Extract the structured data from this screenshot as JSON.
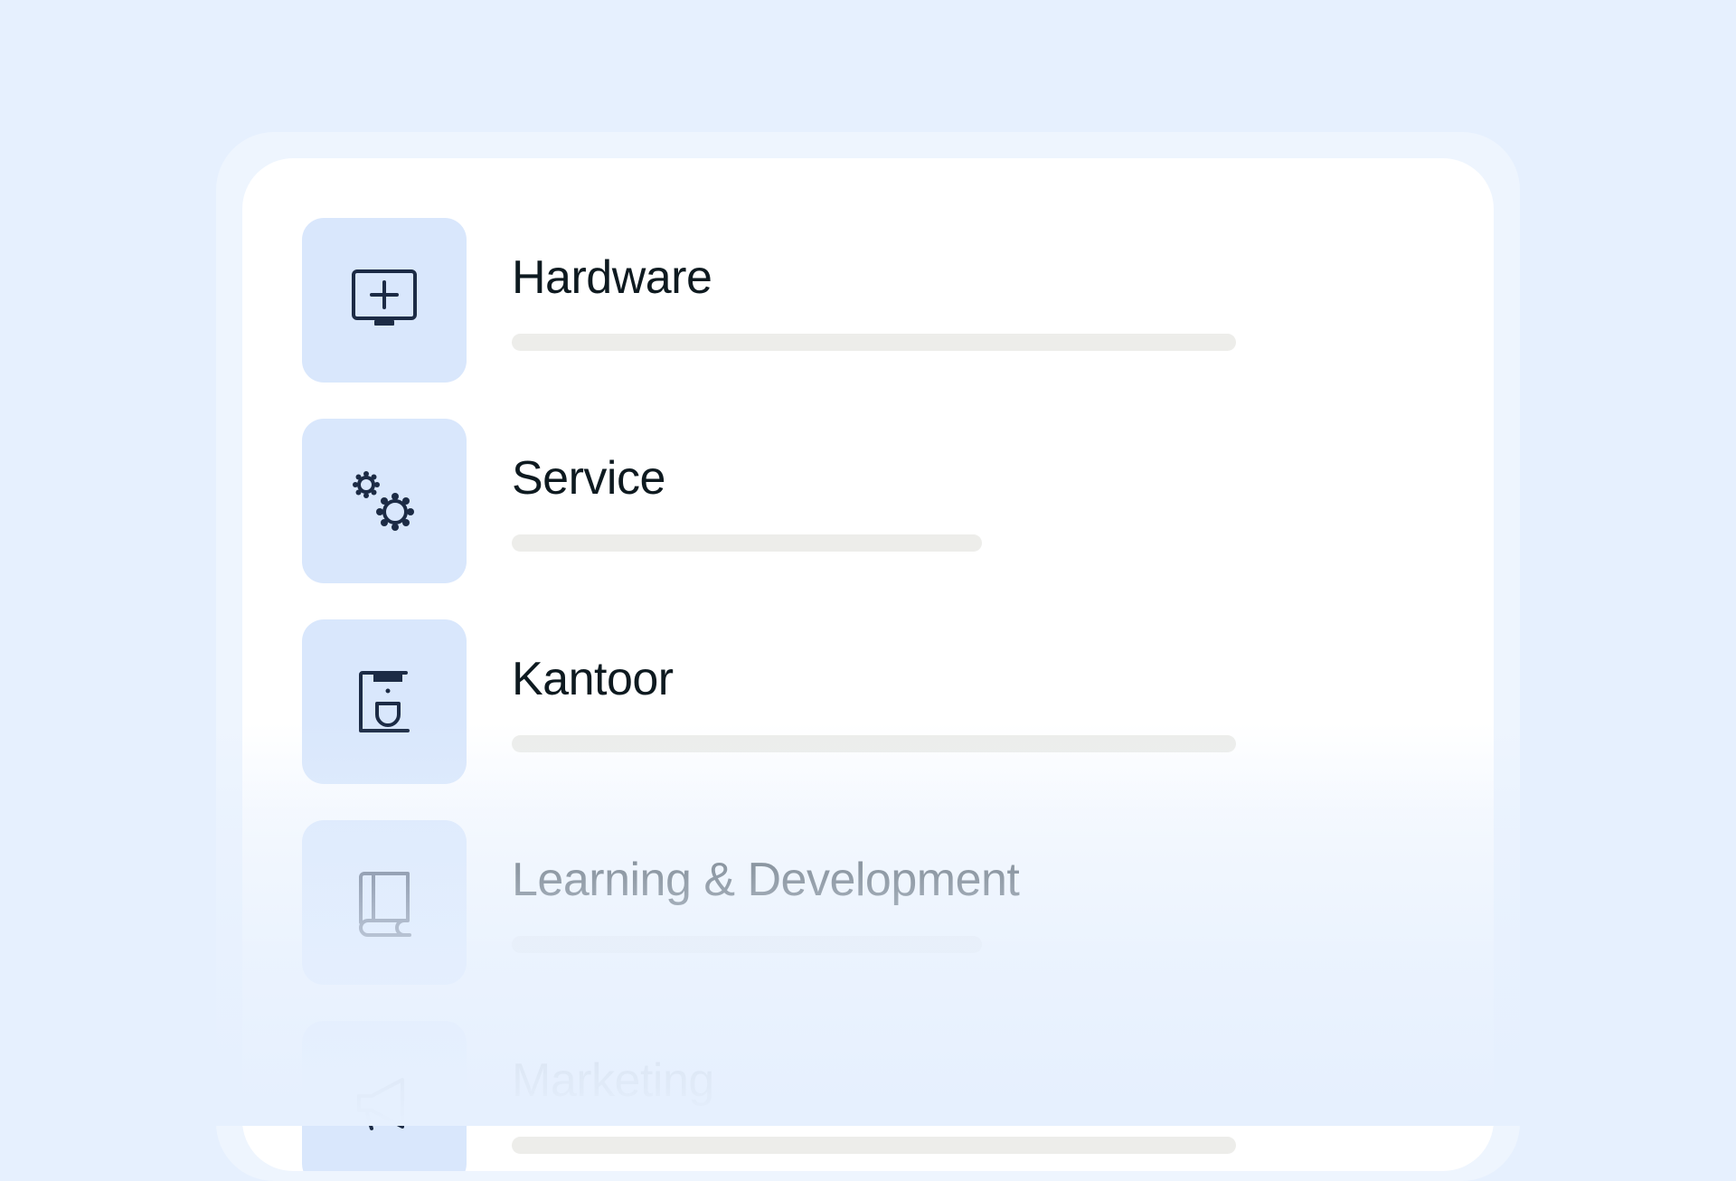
{
  "colors": {
    "background": "#e6f0fe",
    "panel": "#ffffff",
    "icon_tile": "#d9e7fc",
    "icon_stroke": "#1c2b45",
    "label_text": "#0e1a20",
    "bar": "#ededea"
  },
  "categories": [
    {
      "label": "Hardware",
      "icon": "monitor-plus-icon"
    },
    {
      "label": "Service",
      "icon": "gears-icon"
    },
    {
      "label": "Kantoor",
      "icon": "coffee-machine-icon"
    },
    {
      "label": "Learning & Development",
      "icon": "book-icon"
    },
    {
      "label": "Marketing",
      "icon": "megaphone-icon"
    }
  ]
}
